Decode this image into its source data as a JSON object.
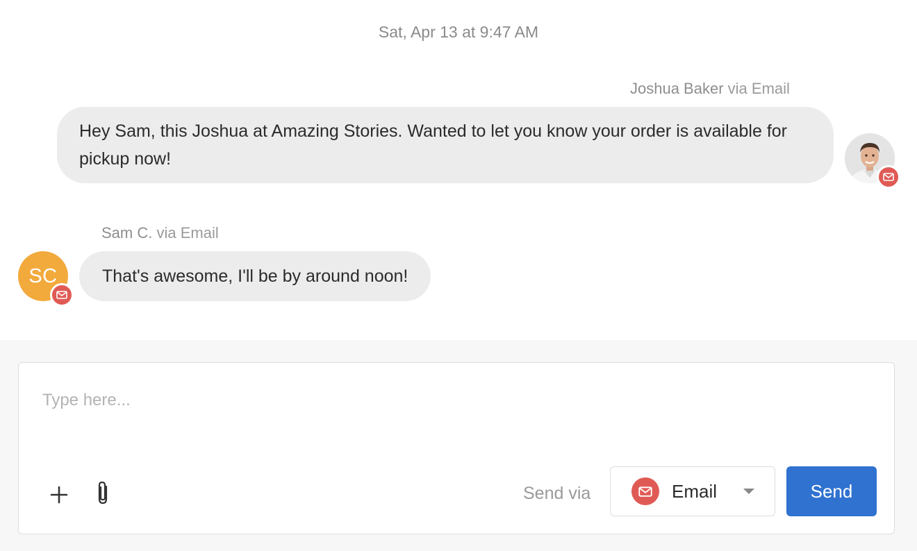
{
  "thread": {
    "timestamp": "Sat, Apr 13 at 9:47 AM",
    "messages": [
      {
        "sender": "Joshua Baker",
        "via": "via Email",
        "text": "Hey Sam, this Joshua at Amazing Stories. Wanted to let you know your order is available for pickup now!",
        "direction": "outgoing",
        "avatar_icon": "person-photo"
      },
      {
        "sender": "Sam C.",
        "via": "via Email",
        "text": "That's awesome, I'll be by around noon!",
        "direction": "incoming",
        "avatar_initials": "SC",
        "avatar_color": "#f2aa3c"
      }
    ]
  },
  "composer": {
    "placeholder": "Type here...",
    "value": "",
    "send_via_label": "Send via",
    "channel": {
      "selected": "Email",
      "icon": "mail-icon",
      "color": "#e05a55"
    },
    "send_label": "Send",
    "send_color": "#2f72d0"
  }
}
